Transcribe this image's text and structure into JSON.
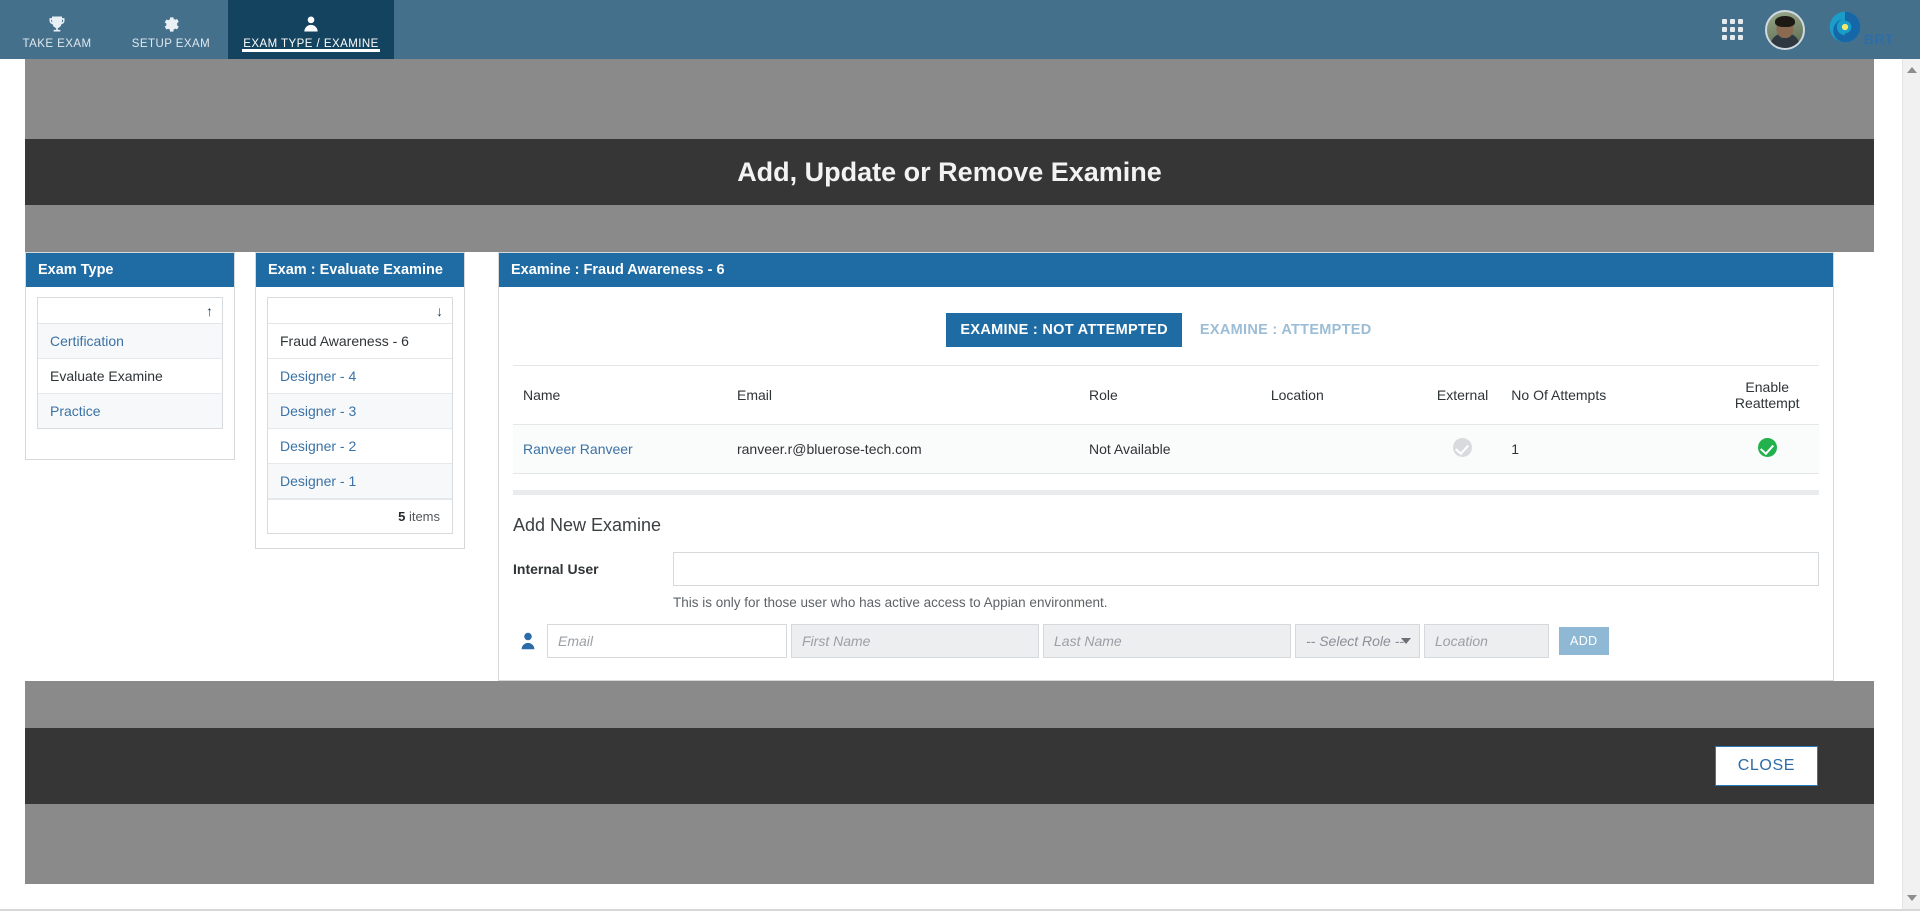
{
  "topnav": {
    "items": [
      {
        "label": "TAKE EXAM",
        "icon": "trophy-icon",
        "active": false
      },
      {
        "label": "SETUP EXAM",
        "icon": "gear-icon",
        "active": false
      },
      {
        "label": "EXAM TYPE / EXAMINE",
        "icon": "user-icon",
        "active": true
      }
    ],
    "apps_icon": "apps-grid-icon",
    "avatar": "user-avatar",
    "brand_text": "BRT",
    "brand_icon": "spiral-logo-icon",
    "bg_color": "#45708c",
    "active_bg_color": "#14435f"
  },
  "page": {
    "title": "Add, Update or Remove Examine",
    "band_color": "#8a8a8a",
    "dark_color": "#363636",
    "accent_color": "#1f6ba4",
    "close_label": "CLOSE"
  },
  "exam_type_panel": {
    "header": "Exam Type",
    "sort_arrow": "↑",
    "items": [
      {
        "label": "Certification",
        "selected": false
      },
      {
        "label": "Evaluate Examine",
        "selected": true
      },
      {
        "label": "Practice",
        "selected": false
      }
    ]
  },
  "exam_list_panel": {
    "header": "Exam : Evaluate Examine",
    "sort_arrow": "↓",
    "items": [
      {
        "label": "Fraud Awareness - 6",
        "selected": true
      },
      {
        "label": "Designer - 4",
        "selected": false
      },
      {
        "label": "Designer - 3",
        "selected": false
      },
      {
        "label": "Designer - 2",
        "selected": false
      },
      {
        "label": "Designer - 1",
        "selected": false
      }
    ],
    "count": "5",
    "count_suffix": " items"
  },
  "examine_panel": {
    "header": "Examine : Fraud Awareness - 6",
    "tabs": [
      {
        "label": "EXAMINE : NOT ATTEMPTED",
        "active": true
      },
      {
        "label": "EXAMINE : ATTEMPTED",
        "active": false
      }
    ],
    "table": {
      "columns": [
        "Name",
        "Email",
        "Role",
        "Location",
        "External",
        "No Of Attempts",
        "Enable Reattempt"
      ],
      "rows": [
        {
          "name": "Ranveer Ranveer",
          "email": "ranveer.r@bluerose-tech.com",
          "role": "Not Available",
          "location": "",
          "external": "check-grey",
          "attempts": "1",
          "reattempt": "check-green"
        }
      ]
    },
    "add_new": {
      "title": "Add New Examine",
      "internal_user_label": "Internal User",
      "internal_user_value": "",
      "internal_user_placeholder": "",
      "help_text": "This is only for those user who has active access to Appian environment.",
      "person_icon": "person-icon",
      "email_placeholder": "Email",
      "first_name_placeholder": "First Name",
      "last_name_placeholder": "Last Name",
      "role_selected": "-- Select Role --",
      "location_placeholder": "Location",
      "add_label": "ADD"
    }
  }
}
